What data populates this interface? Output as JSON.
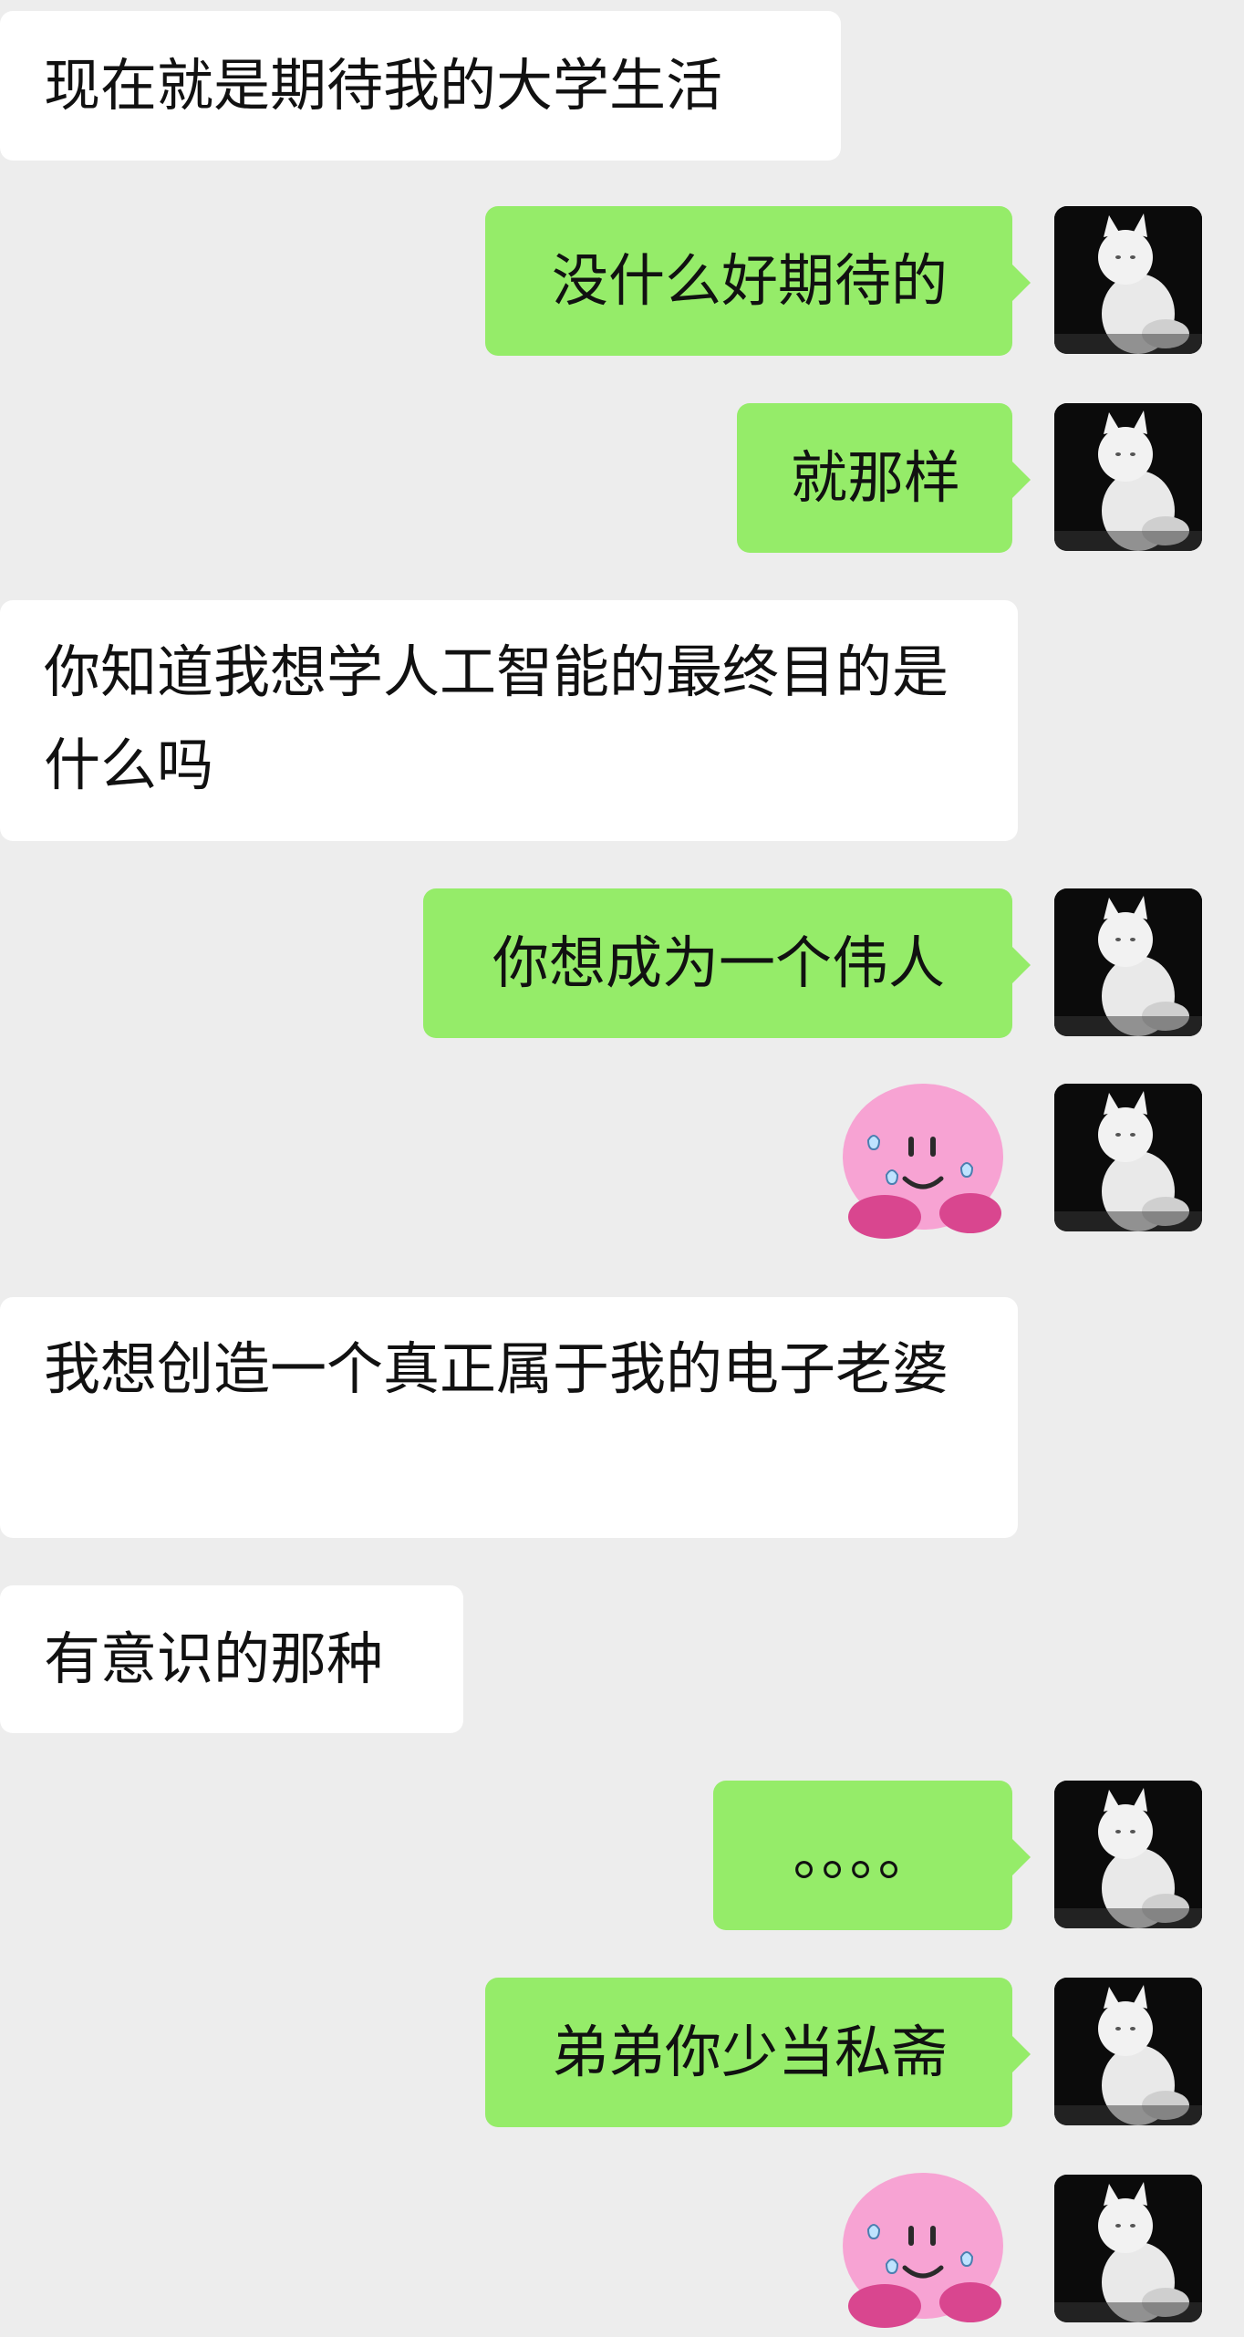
{
  "messages": [
    {
      "side": "in",
      "text": "现在就是期待我的大学生活"
    },
    {
      "side": "out",
      "text": "没什么好期待的"
    },
    {
      "side": "out",
      "text": "就那样"
    },
    {
      "side": "in",
      "text": "你知道我想学人工智能的最终目的是什么吗"
    },
    {
      "side": "out",
      "text": "你想成为一个伟人"
    },
    {
      "side": "out",
      "sticker": "pink-blob-sweat-smile"
    },
    {
      "side": "in",
      "text": "我想创造一个真正属于我的电子老婆"
    },
    {
      "side": "in",
      "text": "有意识的那种"
    },
    {
      "side": "out",
      "text": "。。。。"
    },
    {
      "side": "out",
      "text": "弟弟你少当私斋"
    },
    {
      "side": "out",
      "sticker": "pink-blob-sweat-smile"
    }
  ],
  "avatar_icon": "white-cat-avatar",
  "colors": {
    "background": "#ededed",
    "incoming_bubble": "#ffffff",
    "outgoing_bubble": "#95ec69",
    "sticker_pink": "#f7a3d3"
  }
}
